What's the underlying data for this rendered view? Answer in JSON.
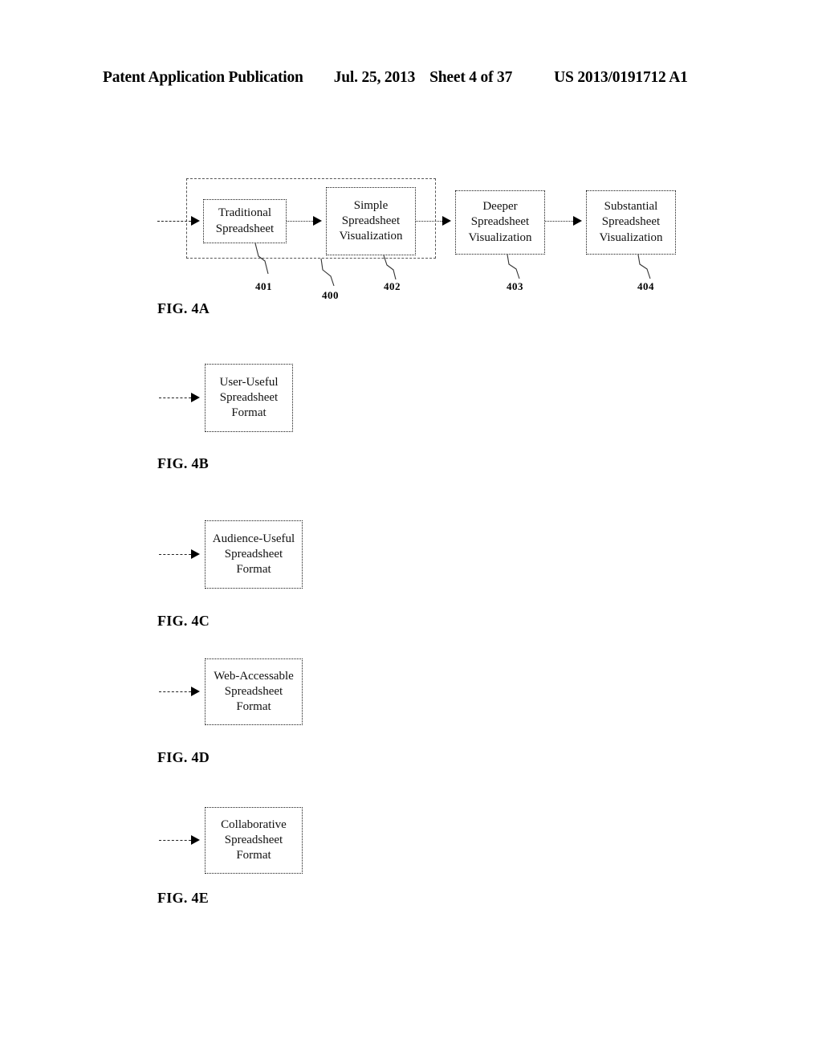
{
  "header": {
    "publication": "Patent Application Publication",
    "date": "Jul. 25, 2013",
    "sheet": "Sheet 4 of 37",
    "patent_number": "US 2013/0191712 A1"
  },
  "figures": [
    {
      "label": "FIG. 4A",
      "group_ref": "400",
      "nodes": [
        {
          "ref": "401",
          "lines": [
            "Traditional",
            "Spreadsheet"
          ]
        },
        {
          "ref": "402",
          "lines": [
            "Simple",
            "Spreadsheet",
            "Visualization"
          ]
        },
        {
          "ref": "403",
          "lines": [
            "Deeper",
            "Spreadsheet",
            "Visualization"
          ]
        },
        {
          "ref": "404",
          "lines": [
            "Substantial",
            "Spreadsheet",
            "Visualization"
          ]
        }
      ]
    },
    {
      "label": "FIG. 4B",
      "nodes": [
        {
          "lines": [
            "User-Useful",
            "Spreadsheet",
            "Format"
          ]
        }
      ]
    },
    {
      "label": "FIG. 4C",
      "nodes": [
        {
          "lines": [
            "Audience-Useful",
            "Spreadsheet",
            "Format"
          ]
        }
      ]
    },
    {
      "label": "FIG. 4D",
      "nodes": [
        {
          "lines": [
            "Web-Accessable",
            "Spreadsheet",
            "Format"
          ]
        }
      ]
    },
    {
      "label": "FIG. 4E",
      "nodes": [
        {
          "lines": [
            "Collaborative",
            "Spreadsheet",
            "Format"
          ]
        }
      ]
    }
  ],
  "colors": {
    "ink": "#000000",
    "line": "#222222",
    "group_border": "#555555",
    "page": "#ffffff"
  }
}
